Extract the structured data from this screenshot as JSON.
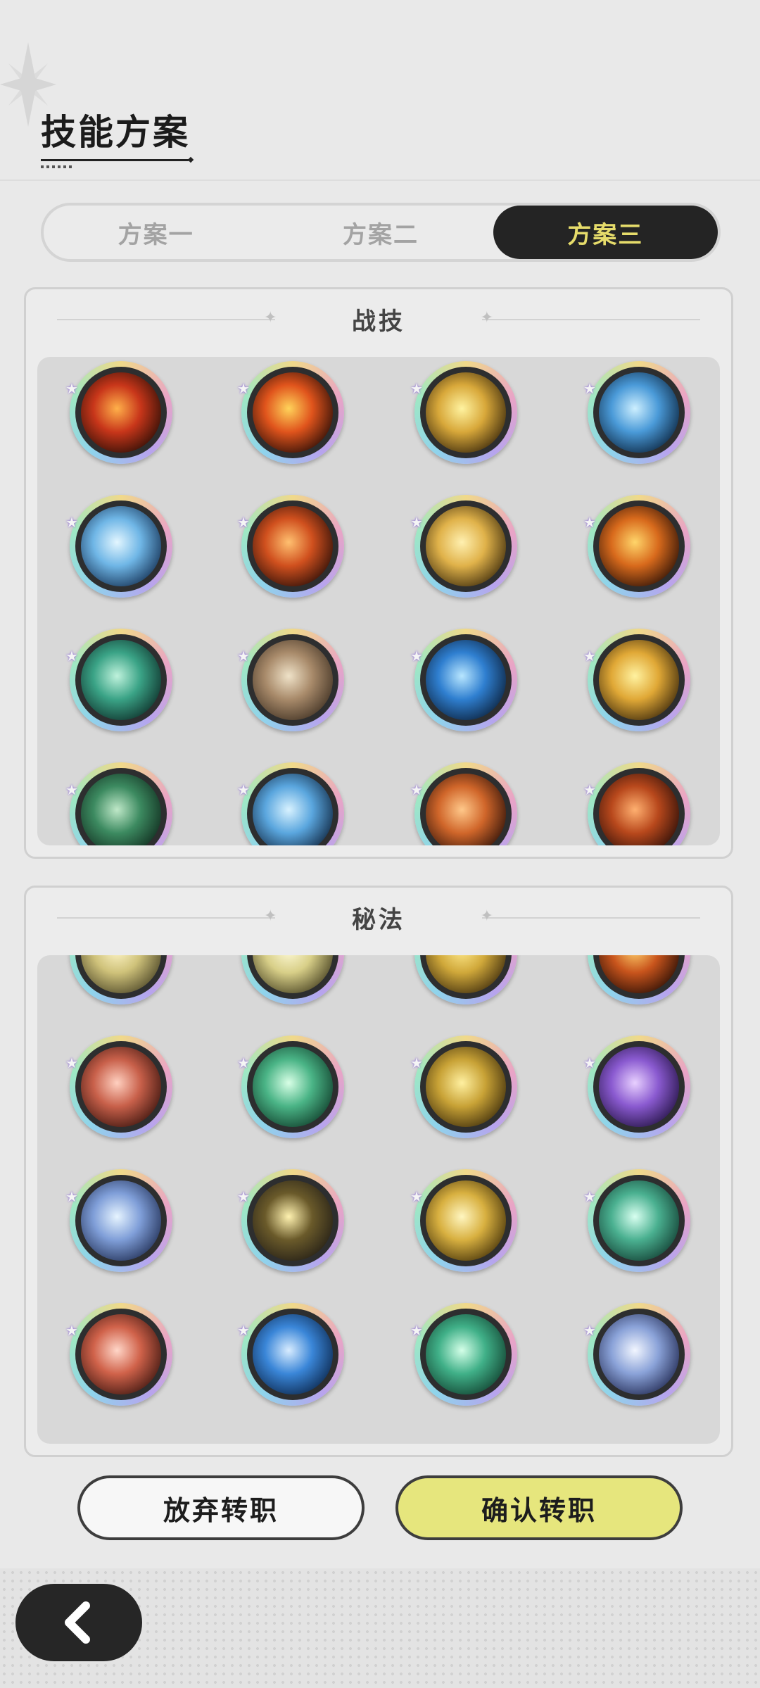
{
  "header": {
    "title": "技能方案"
  },
  "tabs": [
    {
      "label": "方案一",
      "active": false
    },
    {
      "label": "方案二",
      "active": false
    },
    {
      "label": "方案三",
      "active": true
    }
  ],
  "combat_section": {
    "title": "战技",
    "icons": [
      "fireball-skill-icon",
      "flame-burst-skill-icon",
      "star-sparkle-skill-icon",
      "ice-shard-skill-icon",
      "ice-crystal-skill-icon",
      "fire-ring-skill-icon",
      "light-beam-skill-icon",
      "fire-spirit-skill-icon",
      "wind-slash-skill-icon",
      "card-throw-skill-icon",
      "water-splash-skill-icon",
      "golden-burst-skill-icon",
      "thorn-vine-skill-icon",
      "ice-spike-skill-icon",
      "fire-swirl-skill-icon",
      "flame-vortex-skill-icon"
    ]
  },
  "arcane_section": {
    "title": "秘法",
    "icons": [
      "shadow-figure-arcane-icon",
      "holy-figure-arcane-icon",
      "prayer-figure-arcane-icon",
      "fire-sprite-arcane-icon",
      "fire-aura-arcane-icon",
      "heart-heal-arcane-icon",
      "wing-dash-arcane-icon",
      "purple-swirl-arcane-icon",
      "crystal-orb-arcane-icon",
      "halo-ring-arcane-icon",
      "light-sphere-arcane-icon",
      "nature-orb-arcane-icon",
      "fire-meditation-arcane-icon",
      "water-meditation-arcane-icon",
      "wind-meditation-arcane-icon",
      "star-orb-arcane-icon"
    ]
  },
  "buttons": {
    "abandon": "放弃转职",
    "confirm": "确认转职"
  },
  "colors": {
    "tab_active_bg": "#242424",
    "tab_active_text": "#e6dc6b",
    "confirm_bg": "#e6e67d"
  }
}
